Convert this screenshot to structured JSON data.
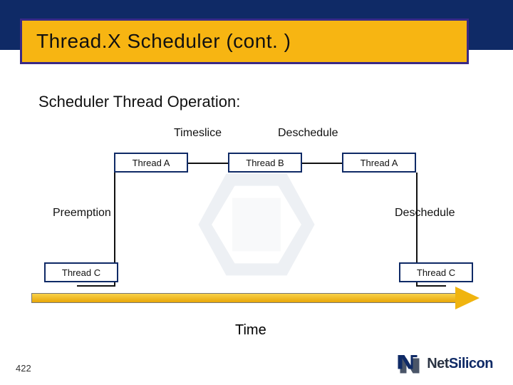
{
  "title": "Thread.X Scheduler (cont. )",
  "subtitle": "Scheduler Thread Operation:",
  "labels": {
    "timeslice": "Timeslice",
    "deschedule_top": "Deschedule",
    "preemption": "Preemption",
    "deschedule_right": "Deschedule"
  },
  "boxes": {
    "thread_a_1": "Thread A",
    "thread_b": "Thread B",
    "thread_a_2": "Thread A",
    "thread_c_left": "Thread C",
    "thread_c_right": "Thread C"
  },
  "timeline_label": "Time",
  "slide_number": "422",
  "logo_text_a": "Net",
  "logo_text_b": "Silicon"
}
